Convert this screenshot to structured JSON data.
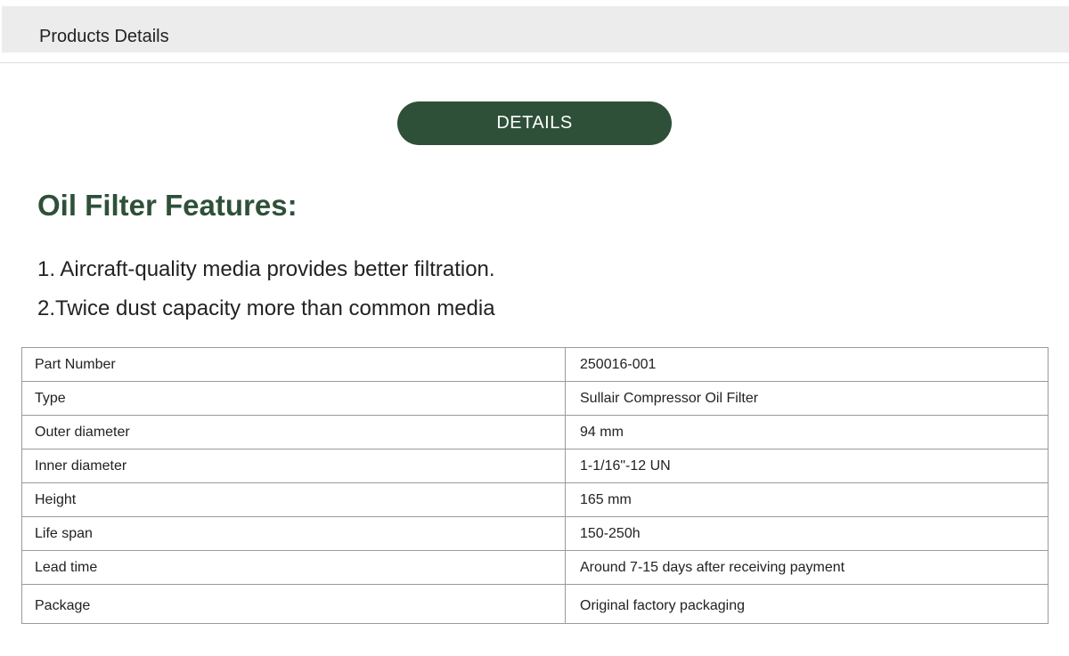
{
  "header": {
    "title": "Products Details"
  },
  "details_button": {
    "label": "DETAILS"
  },
  "features": {
    "heading": "Oil Filter Features:",
    "items": [
      "1. Aircraft-quality media provides better filtration.",
      "2.Twice dust capacity more than common media"
    ]
  },
  "spec_table": {
    "rows": [
      {
        "label": "Part Number",
        "value": "250016-001"
      },
      {
        "label": "Type",
        "value": "Sullair Compressor Oil Filter"
      },
      {
        "label": "Outer diameter",
        "value": "94 mm"
      },
      {
        "label": "Inner diameter",
        "value": "1-1/16\"-12 UN"
      },
      {
        "label": "Height",
        "value": "165 mm"
      },
      {
        "label": "Life span",
        "value": "150-250h"
      },
      {
        "label": "Lead time",
        "value": "Around 7-15 days after receiving payment"
      },
      {
        "label": "Package",
        "value": "Original factory packaging"
      }
    ]
  },
  "colors": {
    "accent_green": "#2f5038",
    "header_bg": "#ececec",
    "table_border": "#9a9a9a"
  }
}
